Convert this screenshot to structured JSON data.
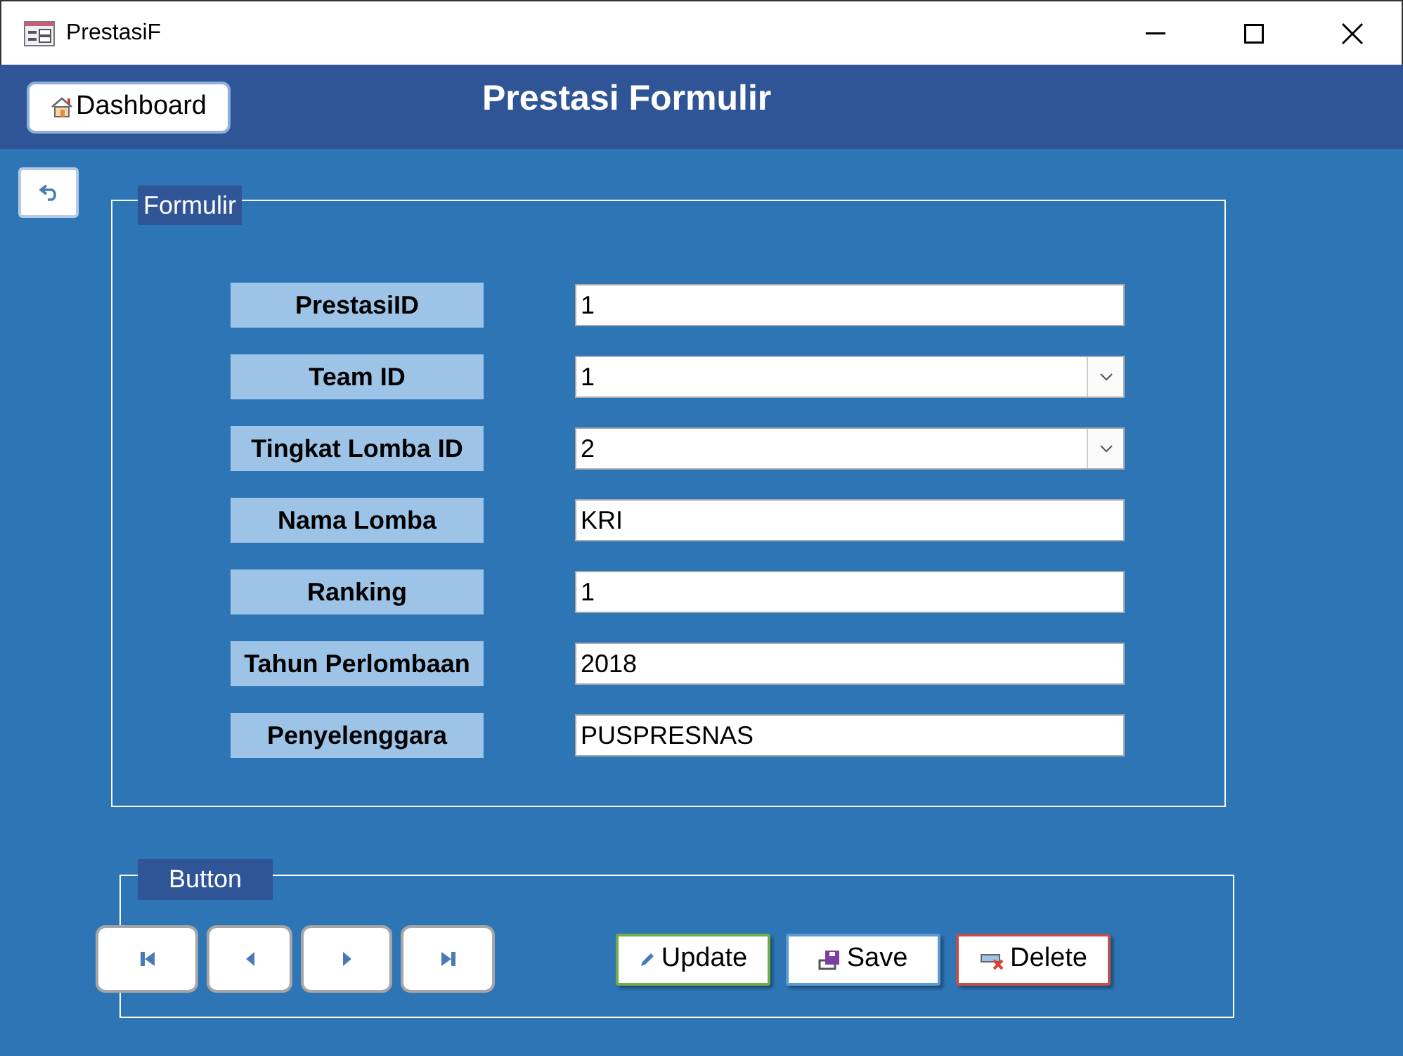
{
  "window": {
    "title": "PrestasiF"
  },
  "header": {
    "dashboard_button": "Dashboard",
    "title": "Prestasi Formulir"
  },
  "form_group": {
    "legend": "Formulir",
    "fields": [
      {
        "label": "PrestasiID",
        "value": "1",
        "kind": "text"
      },
      {
        "label": "Team ID",
        "value": "1",
        "kind": "dropdown"
      },
      {
        "label": "Tingkat Lomba ID",
        "value": "2",
        "kind": "dropdown"
      },
      {
        "label": "Nama Lomba",
        "value": "KRI",
        "kind": "text"
      },
      {
        "label": "Ranking",
        "value": "1",
        "kind": "text"
      },
      {
        "label": "Tahun Perlombaan",
        "value": "2018",
        "kind": "text"
      },
      {
        "label": "Penyelenggara",
        "value": "PUSPRESNAS",
        "kind": "text"
      }
    ]
  },
  "button_group": {
    "legend": "Button",
    "nav_buttons": [
      {
        "kind": "first"
      },
      {
        "kind": "previous"
      },
      {
        "kind": "next"
      },
      {
        "kind": "last"
      }
    ],
    "action_buttons": [
      {
        "label": "Update",
        "kind": "update"
      },
      {
        "label": "Save",
        "kind": "save"
      },
      {
        "label": "Delete",
        "kind": "delete"
      }
    ]
  }
}
